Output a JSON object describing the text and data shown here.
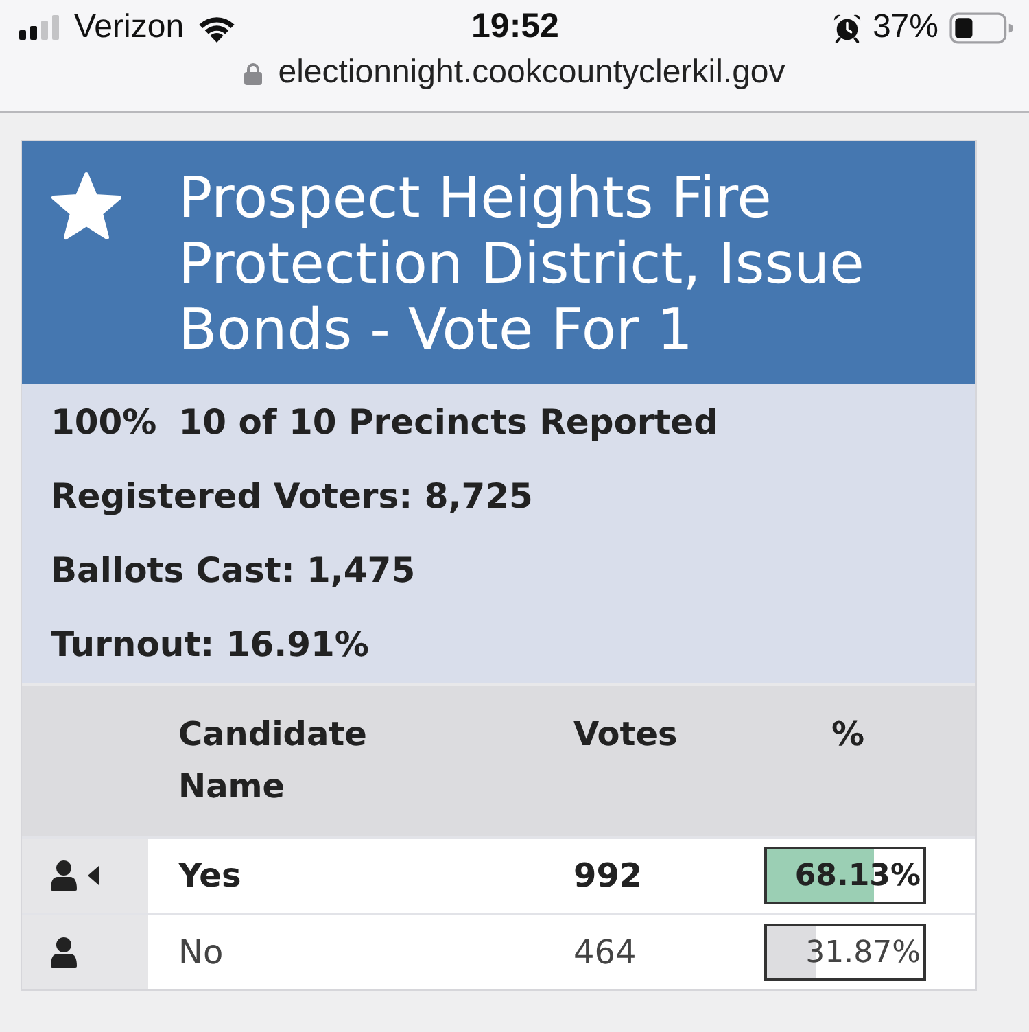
{
  "status_bar": {
    "carrier": "Verizon",
    "time": "19:52",
    "battery": "37%"
  },
  "address_bar": {
    "url": "electionnight.cookcountyclerkil.gov"
  },
  "contest": {
    "title": "Prospect Heights Fire Protection District, Issue Bonds - Vote For 1",
    "precincts_percent": "100%",
    "precincts_reported": "10 of 10 Precincts Reported",
    "stats": [
      "Registered Voters: 8,725",
      "Ballots Cast: 1,475",
      "Turnout: 16.91%"
    ]
  },
  "table": {
    "columns": [
      "Candidate Name",
      "Votes",
      "%"
    ],
    "rows": [
      {
        "name": "Yes",
        "votes": "992",
        "percent": "68.13%",
        "level": 0.6813,
        "winner": true
      },
      {
        "name": "No",
        "votes": "464",
        "percent": "31.87%",
        "level": 0.3187,
        "winner": false
      }
    ]
  }
}
